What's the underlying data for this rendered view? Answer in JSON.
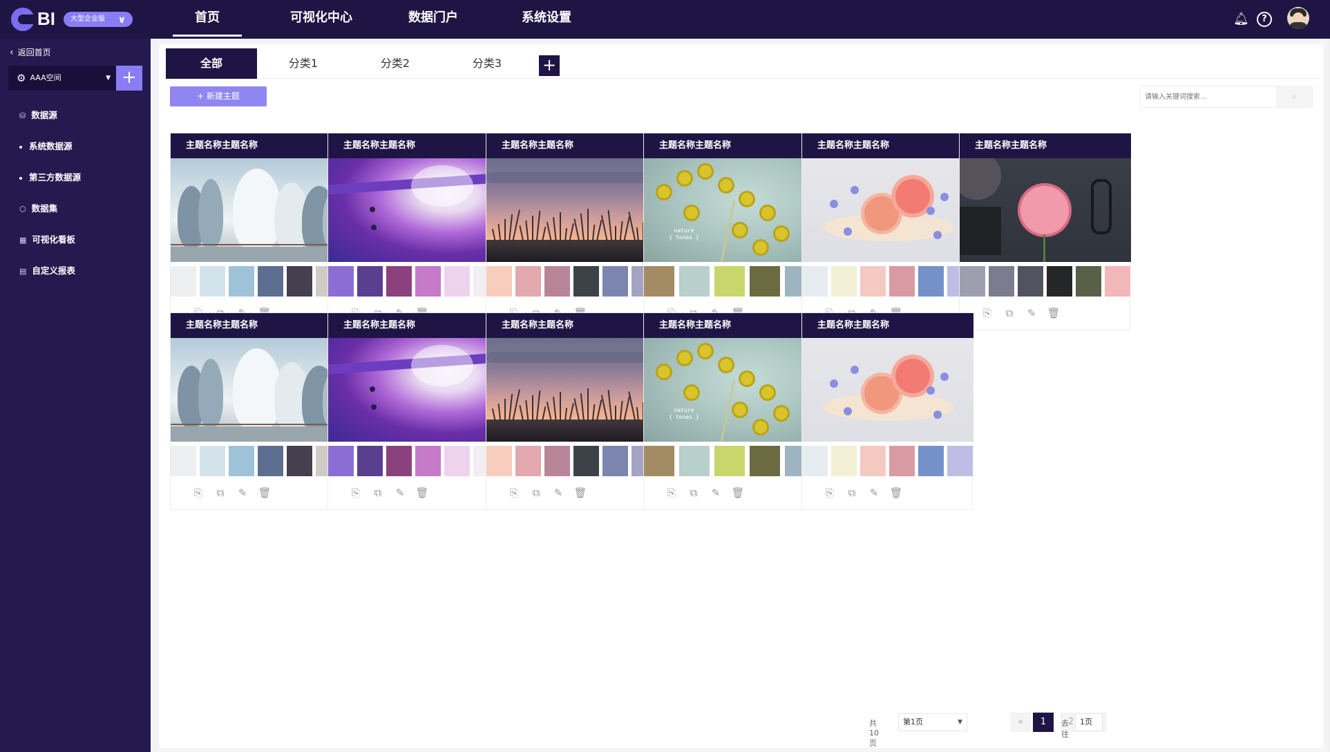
{
  "app": {
    "logo_text": "BI",
    "edition": "大型企业版"
  },
  "nav": [
    {
      "label": "首页",
      "active": true
    },
    {
      "label": "可视化中心",
      "active": false
    },
    {
      "label": "数据门户",
      "active": false
    },
    {
      "label": "系统设置",
      "active": false
    }
  ],
  "sidebar": {
    "back_label": "返回首页",
    "space_name": "AAA空间",
    "items": [
      {
        "label": "数据源",
        "type": "item"
      },
      {
        "label": "系统数据源",
        "type": "sub"
      },
      {
        "label": "第三方数据源",
        "type": "sub"
      },
      {
        "label": "数据集",
        "type": "item"
      },
      {
        "label": "可视化看板",
        "type": "item"
      },
      {
        "label": "自定义报表",
        "type": "item"
      }
    ]
  },
  "tabs": [
    {
      "label": "全部",
      "active": true
    },
    {
      "label": "分类1",
      "active": false
    },
    {
      "label": "分类2",
      "active": false
    },
    {
      "label": "分类3",
      "active": false
    }
  ],
  "toolbar": {
    "new_label": "+ 新建主题",
    "search_placeholder": "请输入关键词搜索..."
  },
  "themes": [
    {
      "title": "主题名称主题名称",
      "image": "winter-trees",
      "palette": [
        "#eeeff0",
        "#d3e3ec",
        "#9ec3d8",
        "#5c6f91",
        "#453f4f",
        "#d0cbc4"
      ]
    },
    {
      "title": "主题名称主题名称",
      "image": "purple-paint",
      "palette": [
        "#8c6dd4",
        "#5a3f91",
        "#8c417f",
        "#c67ac8",
        "#eed3ed",
        "#f3eef3"
      ]
    },
    {
      "title": "主题名称主题名称",
      "image": "sunset-grass",
      "palette": [
        "#f8cdbd",
        "#e2a8ae",
        "#b88597",
        "#3c4248",
        "#7b85b0",
        "#a4a4c2"
      ]
    },
    {
      "title": "主题名称主题名称",
      "image": "yellow-plant",
      "palette": [
        "#a38c63",
        "#b8cfcb",
        "#c8d76b",
        "#6b6a41",
        "#9eb4c1"
      ]
    },
    {
      "title": "主题名称主题名称",
      "image": "pink-flowers",
      "palette": [
        "#e7ecf1",
        "#f2f0d4",
        "#f4c9c1",
        "#d89ba3",
        "#7591c9",
        "#bfbde6"
      ]
    },
    {
      "title": "主题名称主题名称",
      "image": "pink-peony",
      "palette": [
        "#9e9fae",
        "#7b7d8e",
        "#51545f",
        "#242628",
        "#5a6048",
        "#f2b7b9"
      ]
    },
    {
      "title": "主题名称主题名称",
      "image": "winter-trees",
      "palette": [
        "#eeeff0",
        "#d3e3ec",
        "#9ec3d8",
        "#5c6f91",
        "#453f4f",
        "#d0cbc4"
      ]
    },
    {
      "title": "主题名称主题名称",
      "image": "purple-paint",
      "palette": [
        "#8c6dd4",
        "#5a3f91",
        "#8c417f",
        "#c67ac8",
        "#eed3ed",
        "#f3eef3"
      ]
    },
    {
      "title": "主题名称主题名称",
      "image": "sunset-grass",
      "palette": [
        "#f8cdbd",
        "#e2a8ae",
        "#b88597",
        "#3c4248",
        "#7b85b0",
        "#a4a4c2"
      ]
    },
    {
      "title": "主题名称主题名称",
      "image": "yellow-plant",
      "palette": [
        "#a38c63",
        "#b8cfcb",
        "#c8d76b",
        "#6b6a41",
        "#9eb4c1"
      ]
    },
    {
      "title": "主题名称主题名称",
      "image": "pink-flowers",
      "palette": [
        "#e7ecf1",
        "#f2f0d4",
        "#f4c9c1",
        "#d89ba3",
        "#7591c9",
        "#bfbde6"
      ]
    }
  ],
  "card_actions": [
    "copy-icon",
    "preview-icon",
    "edit-icon",
    "delete-icon"
  ],
  "image_overlay_text": {
    "line1": "nature",
    "line2": "{ tones }"
  },
  "pagination": {
    "total": "共 10 页",
    "page_select": "第1页",
    "pages": [
      "1",
      "2"
    ],
    "current": "1",
    "goto_label": "去往",
    "goto_value": "1页"
  },
  "colors": {
    "brand_dark": "#1e1544",
    "sidebar": "#251a4f",
    "accent": "#8a7cf4"
  }
}
